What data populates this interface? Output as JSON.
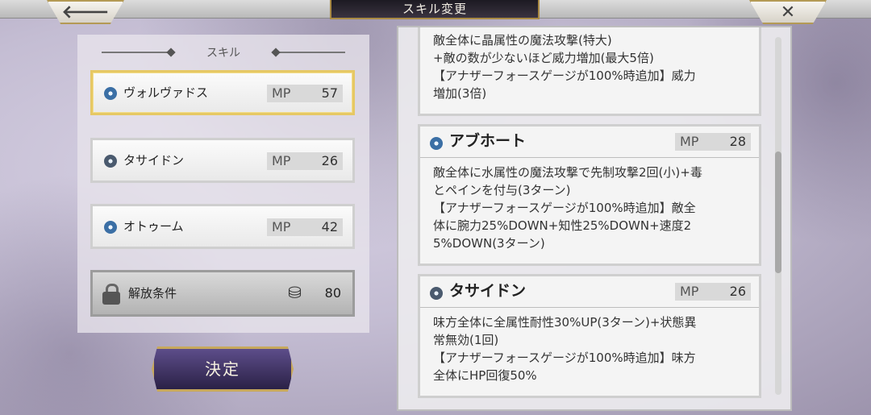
{
  "header": {
    "title": "スキル変更",
    "back_icon": "back-arrow-icon",
    "close_icon": "close-x-icon"
  },
  "left": {
    "section_label": "スキル",
    "skills": [
      {
        "name": "ヴォルヴァドス",
        "mp_label": "MP",
        "mp": "57",
        "icon": "ice-element-icon",
        "selected": true
      },
      {
        "name": "タサイドン",
        "mp_label": "MP",
        "mp": "26",
        "icon": "dark-element-icon",
        "selected": false
      },
      {
        "name": "オトゥーム",
        "mp_label": "MP",
        "mp": "42",
        "icon": "ice-element-icon",
        "selected": false
      }
    ],
    "locked": {
      "label": "解放条件",
      "icon": "lock-icon",
      "cost_icon": "currency-icon",
      "cost": "80"
    },
    "decide_label": "決定"
  },
  "right": {
    "scroll_thumb_fraction": 0.34,
    "scroll_position_fraction": 0.32,
    "cards": [
      {
        "name": "",
        "desc": "敵全体に晶属性の魔法攻撃(特大)\n+敵の数が少ないほど威力増加(最大5倍)\n【アナザーフォースゲージが100%時追加】威力\n増加(3倍)"
      },
      {
        "name": "アブホート",
        "mp_label": "MP",
        "mp": "28",
        "icon": "ice-element-icon",
        "desc": "敵全体に水属性の魔法攻撃で先制攻撃2回(小)+毒\nとペインを付与(3ターン)\n【アナザーフォースゲージが100%時追加】敵全\n体に腕力25%DOWN+知性25%DOWN+速度2\n5%DOWN(3ターン)"
      },
      {
        "name": "タサイドン",
        "mp_label": "MP",
        "mp": "26",
        "icon": "dark-element-icon",
        "desc": "味方全体に全属性耐性30%UP(3ターン)+状態異\n常無効(1回)\n【アナザーフォースゲージが100%時追加】味方\n全体にHP回復50%"
      }
    ]
  }
}
